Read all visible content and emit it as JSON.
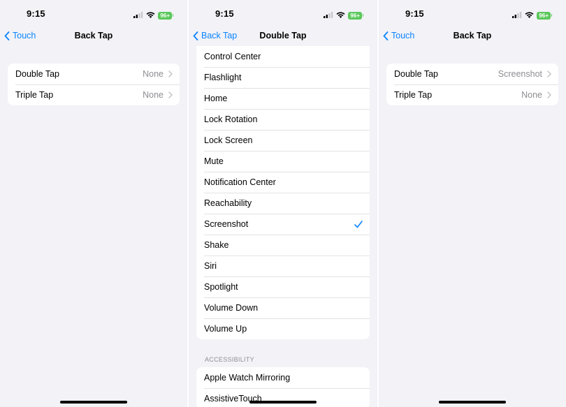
{
  "status_time": "9:15",
  "battery": "96+",
  "left": {
    "back_label": "Touch",
    "title": "Back Tap",
    "rows": [
      {
        "label": "Double Tap",
        "value": "None"
      },
      {
        "label": "Triple Tap",
        "value": "None"
      }
    ]
  },
  "middle": {
    "back_label": "Back Tap",
    "title": "Double Tap",
    "options": [
      {
        "label": "Control Center"
      },
      {
        "label": "Flashlight"
      },
      {
        "label": "Home"
      },
      {
        "label": "Lock Rotation"
      },
      {
        "label": "Lock Screen"
      },
      {
        "label": "Mute"
      },
      {
        "label": "Notification Center"
      },
      {
        "label": "Reachability"
      },
      {
        "label": "Screenshot",
        "selected": true
      },
      {
        "label": "Shake"
      },
      {
        "label": "Siri"
      },
      {
        "label": "Spotlight"
      },
      {
        "label": "Volume Down"
      },
      {
        "label": "Volume Up"
      }
    ],
    "accessibility_header": "ACCESSIBILITY",
    "accessibility_options": [
      {
        "label": "Apple Watch Mirroring"
      },
      {
        "label": "AssistiveTouch"
      }
    ]
  },
  "right": {
    "back_label": "Touch",
    "title": "Back Tap",
    "rows": [
      {
        "label": "Double Tap",
        "value": "Screenshot"
      },
      {
        "label": "Triple Tap",
        "value": "None"
      }
    ]
  },
  "colors": {
    "accent": "#0a84ff",
    "background": "#f2f2f7",
    "battery": "#5ac85a",
    "secondary_text": "#8e8e93"
  },
  "icons": {
    "back": "chevron-left-icon",
    "disclosure": "chevron-right-icon",
    "selected": "checkmark-icon",
    "signal": "cellular-signal-icon",
    "wifi": "wifi-icon",
    "battery": "battery-icon"
  }
}
